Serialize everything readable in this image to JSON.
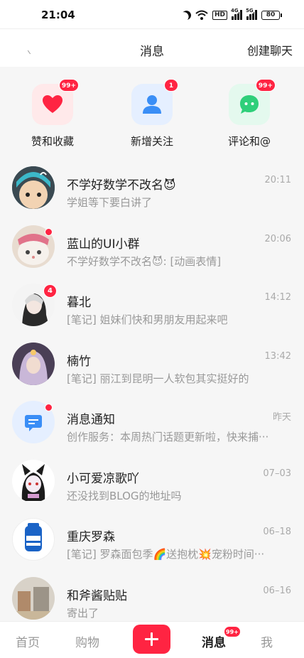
{
  "status_bar": {
    "time": "21:04",
    "hd": "HD",
    "sig1": "4G",
    "sig2": "5G",
    "battery": "80"
  },
  "nav": {
    "title": "消息",
    "action": "创建聊天"
  },
  "quick_actions": [
    {
      "label": "赞和收藏",
      "badge": "99+",
      "icon": "heart-icon",
      "color": "#ff2442",
      "bg": "#ffe9ea"
    },
    {
      "label": "新增关注",
      "badge": "1",
      "icon": "person-icon",
      "color": "#3a8ef6",
      "bg": "#e5efff"
    },
    {
      "label": "评论和@",
      "badge": "99+",
      "icon": "chat-bubble-icon",
      "color": "#2fcf7a",
      "bg": "#e4f9ee"
    }
  ],
  "chats": [
    {
      "name": "不学好数学不改名😈",
      "preview": "学姐等下要白讲了",
      "time": "20:11"
    },
    {
      "name": "蓝山的UI小群",
      "preview": "不学好数学不改名😈: [动画表情]",
      "time": "20:06"
    },
    {
      "name": "暮北",
      "preview": "[笔记] 姐妹们快和男朋友用起来吧",
      "time": "14:12",
      "count": "4"
    },
    {
      "name": "楠竹",
      "preview": "[笔记] 丽江到昆明一人软包其实挺好的",
      "time": "13:42"
    },
    {
      "name": "消息通知",
      "preview": "创作服务：本周热门话题更新啦，快来捕···",
      "time": "昨天"
    },
    {
      "name": "小可爱凉歌吖",
      "preview": "还没找到BLOG的地址吗",
      "time": "07–03"
    },
    {
      "name": "重庆罗森",
      "preview": "[笔记] 罗森面包季🌈送抱枕💥宠粉时间···",
      "time": "06–18"
    },
    {
      "name": "和斧酱贴贴",
      "preview": "寄出了",
      "time": "06–16"
    }
  ],
  "tabs": {
    "home": "首页",
    "shop": "购物",
    "messages": "消息",
    "messages_badge": "99+",
    "me": "我"
  },
  "colors": {
    "accent": "#ff2442"
  }
}
